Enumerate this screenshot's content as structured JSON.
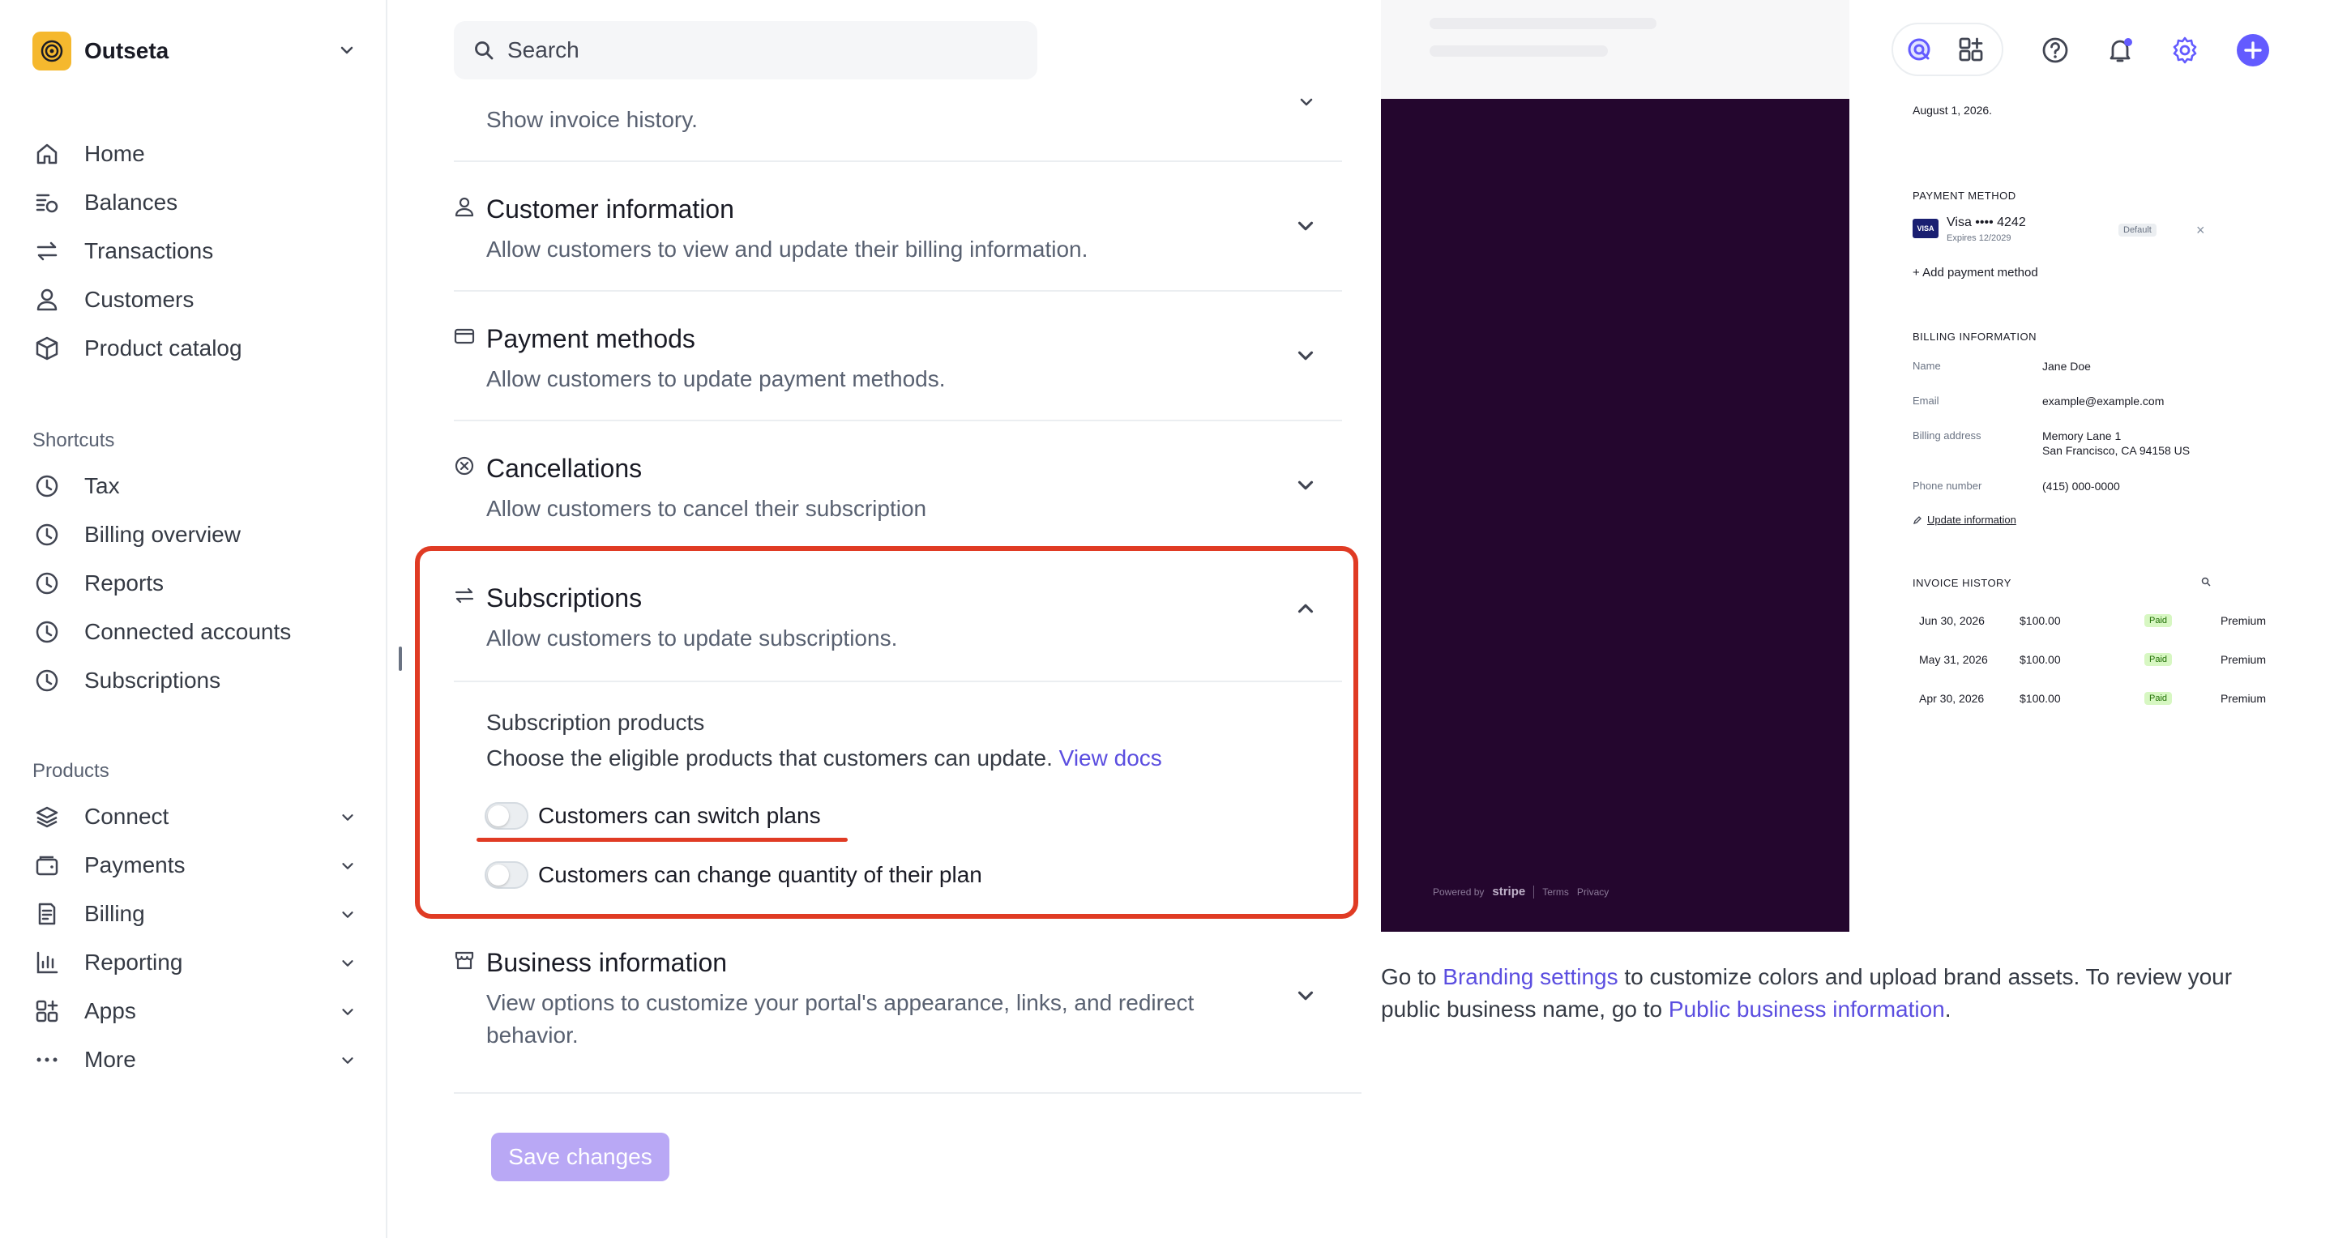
{
  "account": {
    "name": "Outseta"
  },
  "nav": {
    "main": [
      {
        "label": "Home",
        "icon": "home-icon"
      },
      {
        "label": "Balances",
        "icon": "balances-icon"
      },
      {
        "label": "Transactions",
        "icon": "transactions-icon"
      },
      {
        "label": "Customers",
        "icon": "customers-icon"
      },
      {
        "label": "Product catalog",
        "icon": "product-catalog-icon"
      }
    ],
    "shortcuts_heading": "Shortcuts",
    "shortcuts": [
      {
        "label": "Tax",
        "icon": "clock-icon"
      },
      {
        "label": "Billing overview",
        "icon": "clock-icon"
      },
      {
        "label": "Reports",
        "icon": "clock-icon"
      },
      {
        "label": "Connected accounts",
        "icon": "clock-icon"
      },
      {
        "label": "Subscriptions",
        "icon": "clock-icon"
      }
    ],
    "products_heading": "Products",
    "products": [
      {
        "label": "Connect",
        "icon": "connect-icon"
      },
      {
        "label": "Payments",
        "icon": "payments-icon"
      },
      {
        "label": "Billing",
        "icon": "billing-icon"
      },
      {
        "label": "Reporting",
        "icon": "reporting-icon"
      },
      {
        "label": "Apps",
        "icon": "apps-icon"
      },
      {
        "label": "More",
        "icon": "more-icon"
      }
    ]
  },
  "search": {
    "placeholder": "Search"
  },
  "sections": {
    "invoice_history": {
      "desc": "Show invoice history."
    },
    "customer_information": {
      "title": "Customer information",
      "desc": "Allow customers to view and update their billing information."
    },
    "payment_methods": {
      "title": "Payment methods",
      "desc": "Allow customers to update payment methods."
    },
    "cancellations": {
      "title": "Cancellations",
      "desc": "Allow customers to cancel their subscription"
    },
    "subscriptions": {
      "title": "Subscriptions",
      "desc": "Allow customers to update subscriptions.",
      "products_title": "Subscription products",
      "products_desc": "Choose the eligible products that customers can update.",
      "view_docs": "View docs",
      "toggle_switch": "Customers can switch plans",
      "toggle_quantity": "Customers can change quantity of their plan"
    },
    "business_information": {
      "title": "Business information",
      "desc_line1": "View options to customize your portal's appearance, links, and redirect",
      "desc_line2": "behavior."
    }
  },
  "save_button": "Save changes",
  "preview": {
    "date_text": "August 1, 2026.",
    "payment_method_heading": "PAYMENT METHOD",
    "card_brand": "VISA",
    "card_number": "Visa •••• 4242",
    "card_expiry": "Expires 12/2029",
    "default_badge": "Default",
    "add_payment": "Add payment method",
    "billing_heading": "BILLING INFORMATION",
    "billing": [
      {
        "label": "Name",
        "value": "Jane Doe"
      },
      {
        "label": "Email",
        "value": "example@example.com"
      },
      {
        "label": "Billing address",
        "value": "Memory Lane 1",
        "value2": "San Francisco, CA 94158 US"
      },
      {
        "label": "Phone number",
        "value": "(415) 000-0000"
      }
    ],
    "update_info": "Update information",
    "invoice_heading": "INVOICE HISTORY",
    "invoices": [
      {
        "date": "Jun 30, 2026",
        "amount": "$100.00",
        "status": "Paid",
        "plan": "Premium"
      },
      {
        "date": "May 31, 2026",
        "amount": "$100.00",
        "status": "Paid",
        "plan": "Premium"
      },
      {
        "date": "Apr 30, 2026",
        "amount": "$100.00",
        "status": "Paid",
        "plan": "Premium"
      }
    ],
    "powered_by": "Powered by",
    "stripe": "stripe",
    "terms": "Terms",
    "privacy": "Privacy"
  },
  "branding_note": {
    "part1": "Go to ",
    "link1": "Branding settings",
    "part2": " to customize colors and upload brand assets. To review your public business name, go to ",
    "link2": "Public business information",
    "part3": "."
  },
  "colors": {
    "accent": "#635bff",
    "highlight": "#e03b24",
    "preview_bg": "#24062e"
  }
}
